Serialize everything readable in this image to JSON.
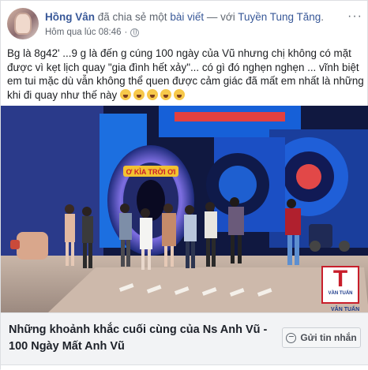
{
  "post": {
    "author": "Hồng Vân",
    "action": " đã chia sẻ một ",
    "shared_item": "bài viết",
    "with_prefix": " — với ",
    "tagged": "Tuyền Tung Tăng",
    "with_suffix": ".",
    "timestamp": "Hôm qua lúc 08:46",
    "separator": "·",
    "more_label": "···",
    "privacy_icon": "globe-icon",
    "text": "Bg là 8g42' ...9 g là đến g cúng 100 ngày của Vũ nhưng chị không có mặt được vì kẹt lịch quay \"gia đình hết xảy\"... có gì đó nghẹn nghẹn ... vĩnh biệt em tui mặc dù vẫn không thể quen được cảm giác đã mất em nhất là những khi đi quay như thế này",
    "emoji_count": 5,
    "emoji_icon": "crying-face-emoji"
  },
  "video": {
    "stage_sign": "Ơ KÌA TRỜI ƠI",
    "watermark": "T",
    "watermark_sub": "VẦN TUẤN",
    "watermark_caption": "VÂN TUẤN"
  },
  "link_preview": {
    "title": "Những khoảnh khắc cuối cùng của Ns Anh Vũ - 100 Ngày Mất Anh Vũ",
    "send_button": "Gửi tin nhắn",
    "send_icon": "messenger-icon"
  },
  "colors": {
    "link": "#385898",
    "stage_blue": "#1e5fd0",
    "stage_red": "#c81e2b"
  }
}
